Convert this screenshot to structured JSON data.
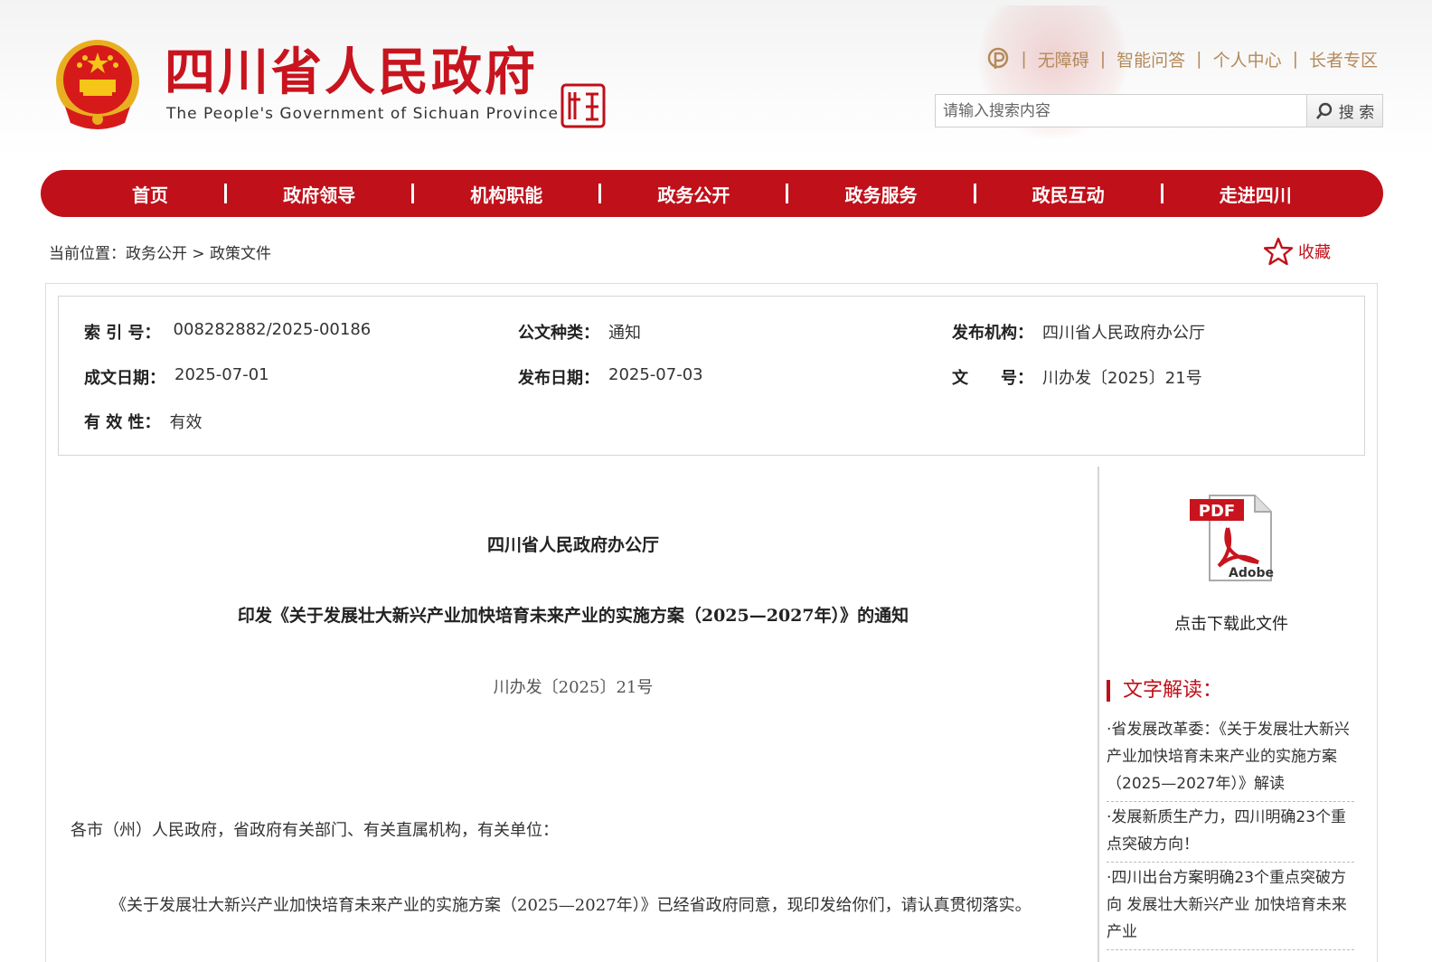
{
  "header": {
    "title": "四川省人民政府",
    "subtitle": "The People's Government of Sichuan Province",
    "links": [
      "无障碍",
      "智能问答",
      "个人中心",
      "长者专区"
    ],
    "search_placeholder": "请输入搜索内容",
    "search_button": "搜 索"
  },
  "nav": [
    "首页",
    "政府领导",
    "机构职能",
    "政务公开",
    "政务服务",
    "政民互动",
    "走进四川"
  ],
  "breadcrumb": "当前位置：政务公开 > 政策文件",
  "favorite": "收藏",
  "meta": {
    "index_label": "索 引 号：",
    "index_value": "008282882/2025-00186",
    "type_label": "公文种类：",
    "type_value": "通知",
    "issuer_label": "发布机构：",
    "issuer_value": "四川省人民政府办公厅",
    "written_label": "成文日期：",
    "written_value": "2025-07-01",
    "publish_label": "发布日期：",
    "publish_value": "2025-07-03",
    "docno_label": "文　　号：",
    "docno_value": "川办发〔2025〕21号",
    "validity_label": "有 效 性：",
    "validity_value": "有效"
  },
  "document": {
    "org": "四川省人民政府办公厅",
    "title": "印发《关于发展壮大新兴产业加快培育未来产业的实施方案（2025—2027年）》的通知",
    "docno": "川办发〔2025〕21号",
    "greeting": "各市（州）人民政府，省政府有关部门、有关直属机构，有关单位：",
    "paragraph": "《关于发展壮大新兴产业加快培育未来产业的实施方案（2025—2027年）》已经省政府同意，现印发给你们，请认真贯彻落实。"
  },
  "sidebar": {
    "download_text": "点击下载此文件",
    "interp_heading": "文字解读：",
    "interp_items": [
      "·省发展改革委：《关于发展壮大新兴产业加快培育未来产业的实施方案（2025—2027年）》解读",
      "·发展新质生产力，四川明确23个重点突破方向！",
      "·四川出台方案明确23个重点突破方向 发展壮大新兴产业 加快培育未来产业"
    ]
  },
  "colors": {
    "brand_red": "#c0101a",
    "link_gold": "#b48a5a"
  }
}
